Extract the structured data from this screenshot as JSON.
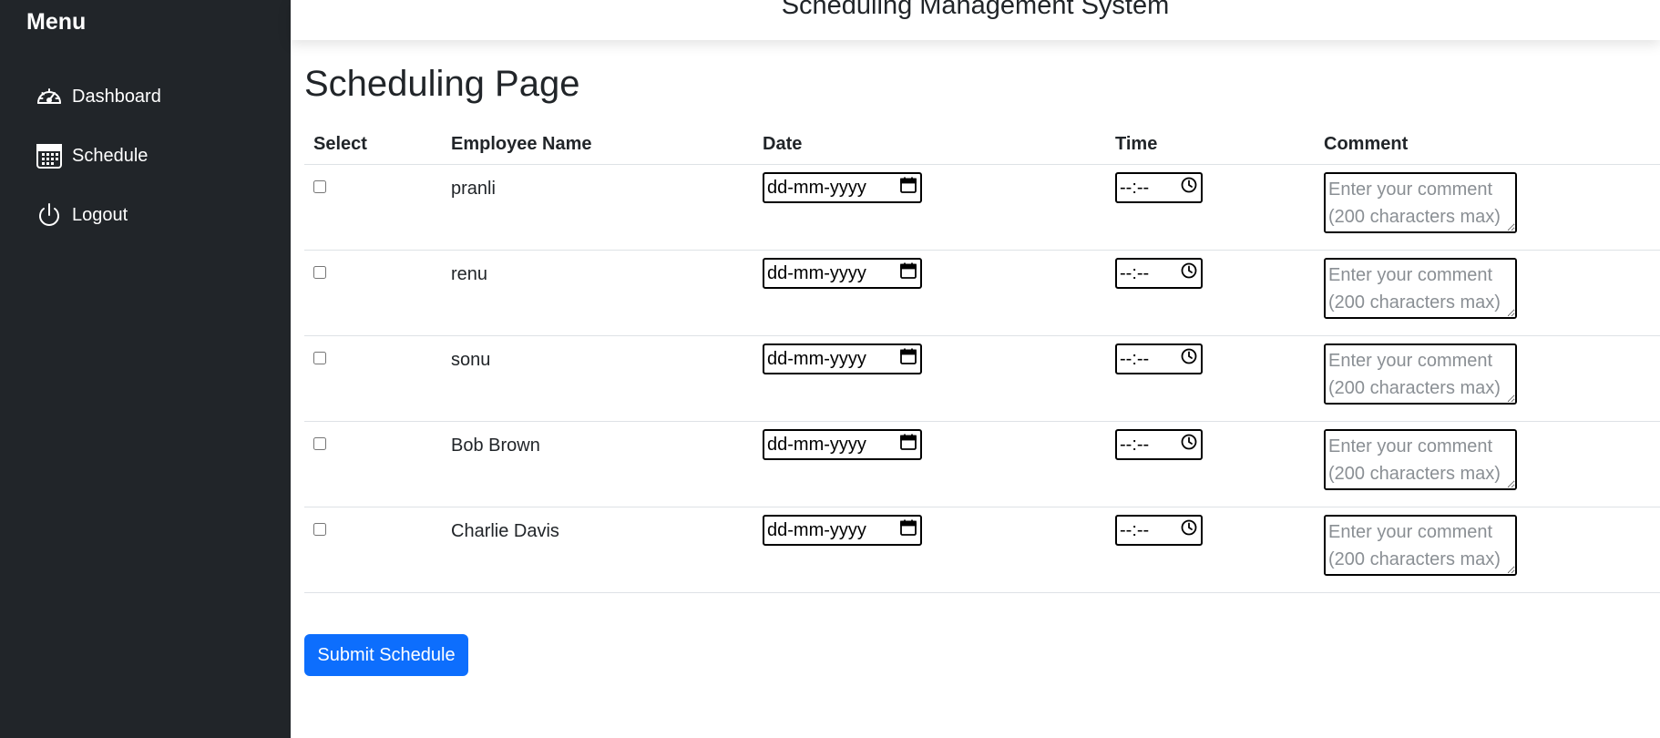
{
  "sidebar": {
    "title": "Menu",
    "items": [
      {
        "label": "Dashboard",
        "icon": "speedometer-icon"
      },
      {
        "label": "Schedule",
        "icon": "calendar-icon"
      },
      {
        "label": "Logout",
        "icon": "power-icon"
      }
    ]
  },
  "header": {
    "title": "Scheduling Management System"
  },
  "main": {
    "title": "Scheduling Page",
    "table": {
      "columns": [
        "Select",
        "Employee Name",
        "Date",
        "Time",
        "Comment"
      ],
      "date_placeholder": "dd-mm-yyyy",
      "time_placeholder": "--:--",
      "comment_placeholder": "Enter your comment (200 characters max)",
      "rows": [
        {
          "name": "pranli",
          "selected": false
        },
        {
          "name": "renu",
          "selected": false
        },
        {
          "name": "sonu",
          "selected": false
        },
        {
          "name": "Bob Brown",
          "selected": false
        },
        {
          "name": "Charlie Davis",
          "selected": false
        }
      ]
    },
    "submit_label": "Submit Schedule"
  },
  "colors": {
    "sidebar_bg": "#212529",
    "primary": "#0d6efd"
  }
}
